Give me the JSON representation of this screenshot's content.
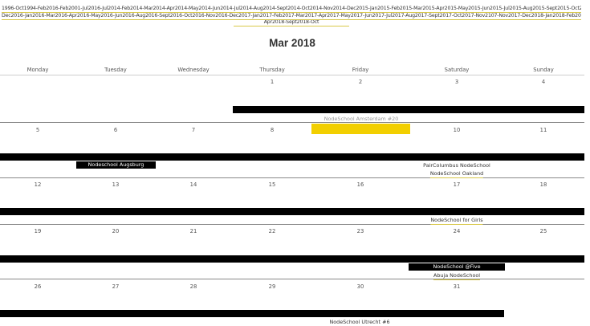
{
  "archive": {
    "line1": "1996-Oct1994-Feb2016-Feb2001-Jul2016-Jul2014-Feb2014-Mar2014-Apr2014-May2014-Jun2014-Jul2014-Aug2014-Sept2014-Oct2014-Nov2014-Dec2015-Jan2015-Feb2015-Mar2015-Apr2015-May2015-Jun2015-Jul2015-Aug2015-Sept2015-Oct2015-Nov2015-",
    "line2": "Dec2016-Jan2016-Mar2016-Apr2016-May2016-Jun2016-Aug2016-Sept2016-Oct2016-Nov2016-Dec2017-Jan2017-Feb2017-Mar2017-Apr2017-May2017-Jun2017-Jul2017-Aug2017-Sept2017-Oct2017-Nov2107-Nov2017-Dec2018-Jan2018-Feb2018-Mar2018-",
    "line3": "Apr2018-Sept2018-Oct"
  },
  "calendar": {
    "title": "Mar 2018",
    "weekdays": [
      "Monday",
      "Tuesday",
      "Wednesday",
      "Thursday",
      "Friday",
      "Saturday",
      "Sunday"
    ],
    "weeks": [
      [
        "",
        "",
        "",
        "1",
        "2",
        "3",
        "4"
      ],
      [
        "5",
        "6",
        "7",
        "8",
        "9",
        "10",
        "11"
      ],
      [
        "12",
        "13",
        "14",
        "15",
        "16",
        "17",
        "18"
      ],
      [
        "19",
        "20",
        "21",
        "22",
        "23",
        "24",
        "25"
      ],
      [
        "26",
        "27",
        "28",
        "29",
        "30",
        "31",
        ""
      ]
    ],
    "today": "9"
  },
  "events": {
    "amsterdam": "NodeSchool Amsterdam #20",
    "augsburg": "Nodeschool Augsburg",
    "paircolumbus": "PairColumbus NodeSchool",
    "oakland": "NodeSchool Oakland",
    "forgirls": "NodeSchool for Girls",
    "atfive": "NodeSchool @Five",
    "abuja": "Abuja NodeSchool",
    "utrecht": "NodeSchool Utrecht #6"
  },
  "colors": {
    "today_highlight": "#f2cf00",
    "event_bar": "#000000",
    "link_underline": "#d8c84a"
  }
}
